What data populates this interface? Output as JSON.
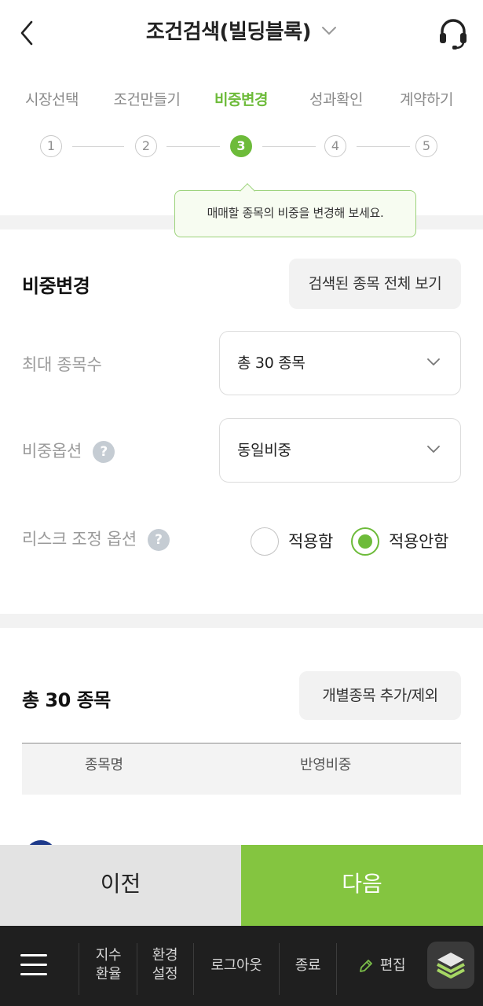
{
  "header": {
    "title": "조건검색(빌딩블록)",
    "back_icon": "chevron-left-icon",
    "dropdown_icon": "chevron-down-icon",
    "support_icon": "headset-icon"
  },
  "steps": [
    {
      "label": "시장선택",
      "number": "1"
    },
    {
      "label": "조건만들기",
      "number": "2"
    },
    {
      "label": "비중변경",
      "number": "3"
    },
    {
      "label": "성과확인",
      "number": "4"
    },
    {
      "label": "계약하기",
      "number": "5"
    }
  ],
  "active_step": 3,
  "tooltip": "매매할 종목의 비중을 변경해 보세요.",
  "weight_section": {
    "title": "비중변경",
    "view_all_button": "검색된 종목 전체 보기",
    "max_stocks_label": "최대 종목수",
    "max_stocks_value": "총 30 종목",
    "weight_option_label": "비중옵션",
    "weight_option_value": "동일비중",
    "risk_option_label": "리스크 조정 옵션",
    "help_icon_text": "?",
    "risk_apply": "적용함",
    "risk_not_apply": "적용안함",
    "risk_selected": "적용안함"
  },
  "stock_section": {
    "total_label": "총 30 종목",
    "edit_button": "개별종목 추가/제외",
    "columns": [
      "종목명",
      "반영비중"
    ]
  },
  "actions": {
    "prev": "이전",
    "next": "다음"
  },
  "bottom_bar": {
    "index_rate_line1": "지수",
    "index_rate_line2": "환율",
    "settings_line1": "환경",
    "settings_line2": "설정",
    "logout": "로그아웃",
    "exit": "종료",
    "edit": "편집",
    "layers_icon": "layers-icon"
  },
  "colors": {
    "accent": "#6dbb3a",
    "next_button": "#84c540",
    "prev_button": "#e3e3e3",
    "bottom_bar": "#1f1f1f"
  }
}
